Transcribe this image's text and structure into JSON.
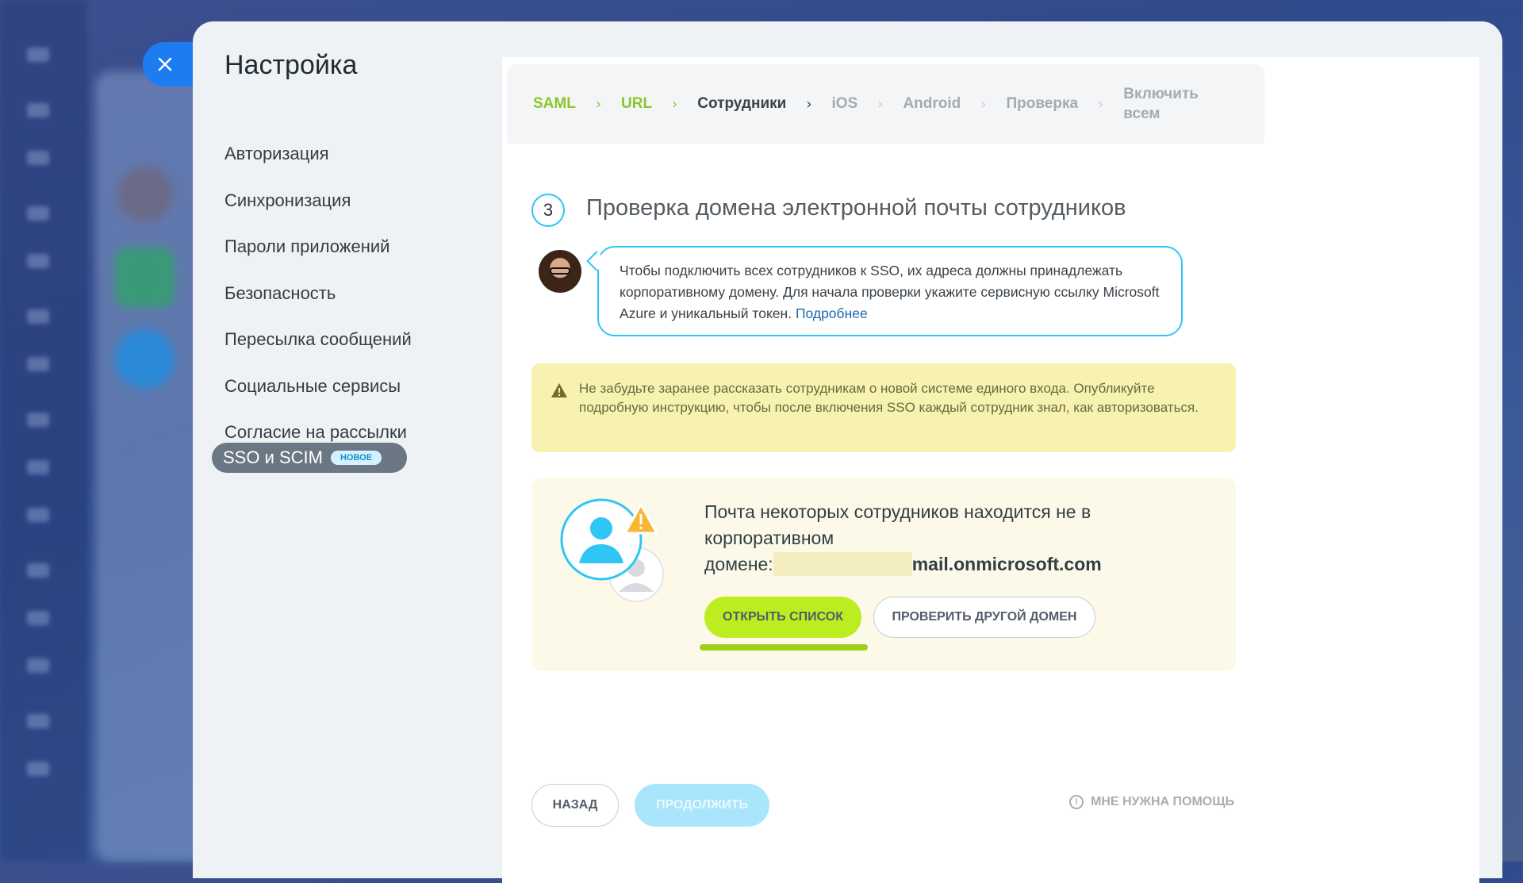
{
  "modal": {
    "title": "Настройка"
  },
  "menu": {
    "items": [
      {
        "label": "Авторизация"
      },
      {
        "label": "Синхронизация"
      },
      {
        "label": "Пароли приложений"
      },
      {
        "label": "Безопасность"
      },
      {
        "label": "Пересылка сообщений"
      },
      {
        "label": "Социальные сервисы"
      },
      {
        "label": "Согласие на рассылки"
      }
    ],
    "active": {
      "label": "SSO и SCIM",
      "badge": "НОВОЕ"
    }
  },
  "steps": [
    {
      "label": "SAML",
      "state": "done"
    },
    {
      "label": "URL",
      "state": "done"
    },
    {
      "label": "Сотрудники",
      "state": "current"
    },
    {
      "label": "iOS",
      "state": "pending"
    },
    {
      "label": "Android",
      "state": "pending"
    },
    {
      "label": "Проверка",
      "state": "pending"
    },
    {
      "label": "Включить всем",
      "state": "pending"
    }
  ],
  "section": {
    "number": "3",
    "title": "Проверка домена электронной почты сотрудников"
  },
  "bubble": {
    "text": "Чтобы подключить всех сотрудников к SSO, их адреса должны принадлежать корпоративному домену. Для начала проверки укажите сервисную ссылку Microsoft Azure и уникальный токен.",
    "link": "Подробнее"
  },
  "warning": {
    "text": "Не забудьте заранее рассказать сотрудникам о новой системе единого входа. Опубликуйте подробную инструкцию, чтобы после включения SSO каждый сотрудник знал, как авторизоваться."
  },
  "notice": {
    "line1": "Почта некоторых сотрудников находится не в корпоративном",
    "prefix": "домене:",
    "domain": "mail.onmicrosoft.com",
    "open_list": "ОТКРЫТЬ СПИСОК",
    "check_other": "ПРОВЕРИТЬ ДРУГОЙ ДОМЕН"
  },
  "footer": {
    "back": "НАЗАД",
    "continue": "ПРОДОЛЖИТЬ",
    "help": "МНЕ НУЖНА ПОМОЩЬ"
  },
  "colors": {
    "accent_green": "#bbed21",
    "accent_blue": "#2fc6f6",
    "close_blue": "#1e7cf2",
    "warning_bg": "#f8f2b0"
  }
}
